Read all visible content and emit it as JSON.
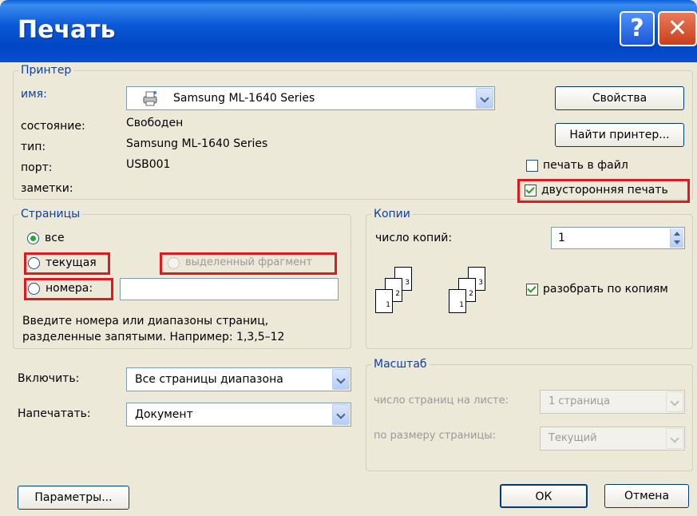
{
  "window": {
    "title": "Печать",
    "help_label": "?",
    "close_label": "✕",
    "colors": {
      "titlebar": "#0b58d6",
      "highlight_box": "#e01820",
      "group_label": "#0b3fa6"
    }
  },
  "printer": {
    "group_label": "Принтер",
    "name_label": "имя:",
    "selected": "Samsung ML-1640 Series",
    "properties_button": "Свойства",
    "find_button": "Найти принтер...",
    "status_label": "состояние:",
    "status_value": "Свободен",
    "type_label": "тип:",
    "type_value": "Samsung ML-1640 Series",
    "port_label": "порт:",
    "port_value": "USB001",
    "notes_label": "заметки:",
    "print_to_file": {
      "label": "печать в файл",
      "checked": false
    },
    "duplex": {
      "label": "двусторонняя печать",
      "checked": true
    },
    "icon": "printer-icon"
  },
  "pages": {
    "group_label": "Страницы",
    "all": "все",
    "current": "текущая",
    "selection": "выделенный фрагмент",
    "numbers": "номера:",
    "numbers_value": "",
    "hint": "Введите номера или диапазоны страниц, разделенные запятыми. Например: 1,3,5–12",
    "selected_option": "все"
  },
  "copies": {
    "group_label": "Копии",
    "count_label": "число копий:",
    "count_value": "1",
    "collate": {
      "label": "разобрать по копиям",
      "checked": true
    },
    "page_numbers": [
      "3",
      "2",
      "1",
      "3",
      "2",
      "1"
    ]
  },
  "include": {
    "label": "Включить:",
    "value": "Все страницы диапазона"
  },
  "print_what": {
    "label": "Напечатать:",
    "value": "Документ"
  },
  "scale": {
    "group_label": "Масштаб",
    "pages_per_sheet_label": "число страниц на листе:",
    "pages_per_sheet_value": "1 страница",
    "fit_label": "по размеру страницы:",
    "fit_value": "Текущий"
  },
  "footer": {
    "options_button": "Параметры...",
    "ok_button": "ОК",
    "cancel_button": "Отмена"
  }
}
